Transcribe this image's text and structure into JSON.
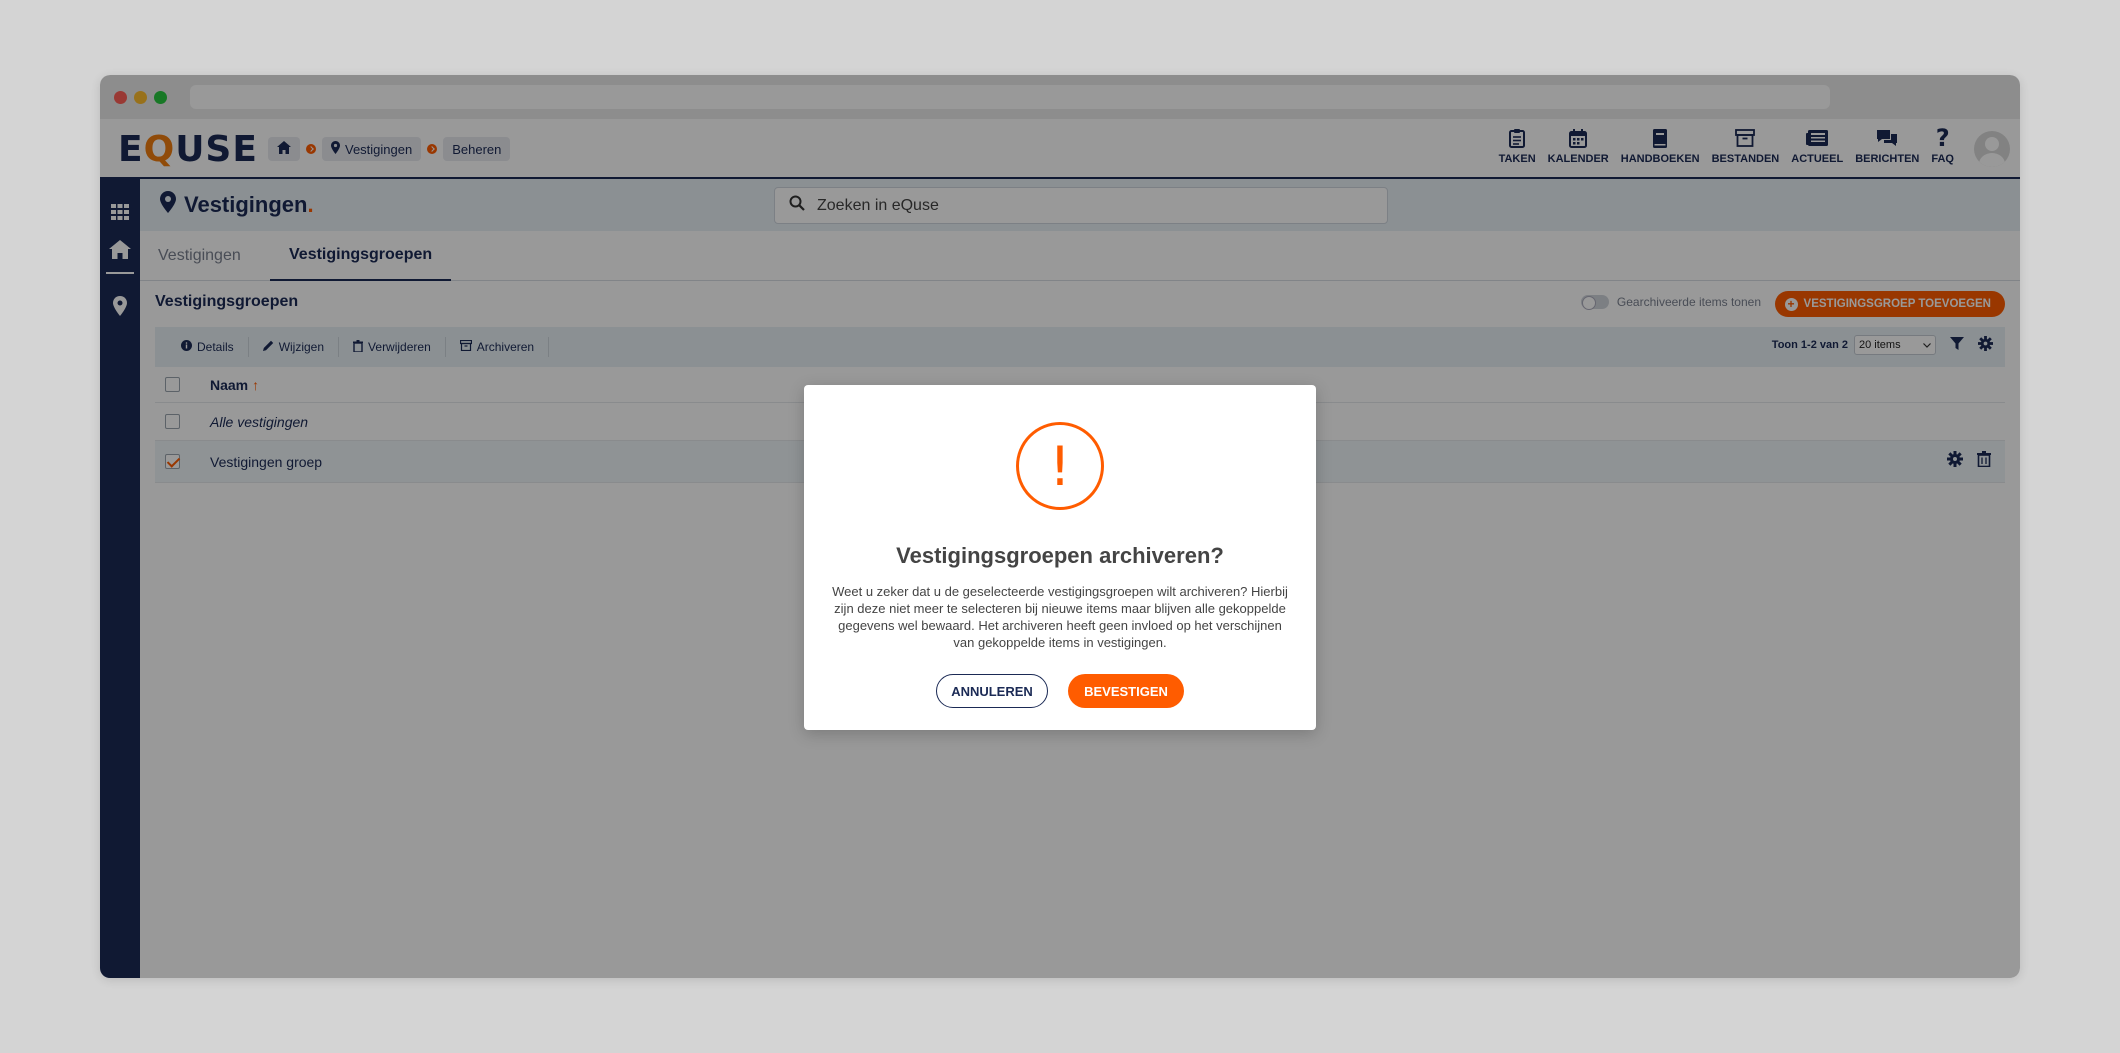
{
  "app": {
    "logo": {
      "pre": "E",
      "q": "Q",
      "post": "USE"
    }
  },
  "breadcrumb": {
    "items": [
      {
        "icon": "home-icon",
        "label": ""
      },
      {
        "icon": "map-pin-icon",
        "label": "Vestigingen"
      },
      {
        "icon": "",
        "label": "Beheren"
      }
    ]
  },
  "topnav": {
    "items": [
      {
        "label": "TAKEN",
        "icon": "clipboard-icon"
      },
      {
        "label": "KALENDER",
        "icon": "calendar-icon"
      },
      {
        "label": "HANDBOEKEN",
        "icon": "book-icon"
      },
      {
        "label": "BESTANDEN",
        "icon": "archive-box-icon"
      },
      {
        "label": "ACTUEEL",
        "icon": "newspaper-icon"
      },
      {
        "label": "BERICHTEN",
        "icon": "chat-icon"
      },
      {
        "label": "FAQ",
        "icon": "question-icon"
      }
    ]
  },
  "page": {
    "title": "Vestigingen",
    "title_dot": ".",
    "search_placeholder": "Zoeken in eQuse"
  },
  "tabs": [
    {
      "label": "Vestigingen",
      "active": false
    },
    {
      "label": "Vestigingsgroepen",
      "active": true
    }
  ],
  "section": {
    "title": "Vestigingsgroepen",
    "toggle_label": "Gearchiveerde items tonen",
    "add_button": "VESTIGINGSGROEP TOEVOEGEN"
  },
  "toolbar": {
    "details": "Details",
    "edit": "Wijzigen",
    "delete": "Verwijderen",
    "archive": "Archiveren",
    "pager_text": "Toon 1-2 van 2",
    "page_size": "20 items"
  },
  "table": {
    "columns": [
      "Naam"
    ],
    "rows": [
      {
        "name": "Alle vestigingen",
        "italic": true,
        "checked": false
      },
      {
        "name": "Vestigingen groep",
        "italic": false,
        "checked": true
      }
    ]
  },
  "modal": {
    "title": "Vestigingsgroepen archiveren?",
    "body": "Weet u zeker dat u de geselecteerde vestigingsgroepen wilt archiveren? Hierbij zijn deze niet meer te selecteren bij nieuwe items maar blijven alle gekoppelde gegevens wel bewaard. Het archiveren heeft geen invloed op het verschijnen van gekoppelde items in vestigingen.",
    "cancel": "ANNULEREN",
    "confirm": "BEVESTIGEN",
    "icon": "!"
  },
  "colors": {
    "navy": "#1b2a55",
    "accent": "#ff5c00",
    "logo_q": "#f07d10"
  }
}
